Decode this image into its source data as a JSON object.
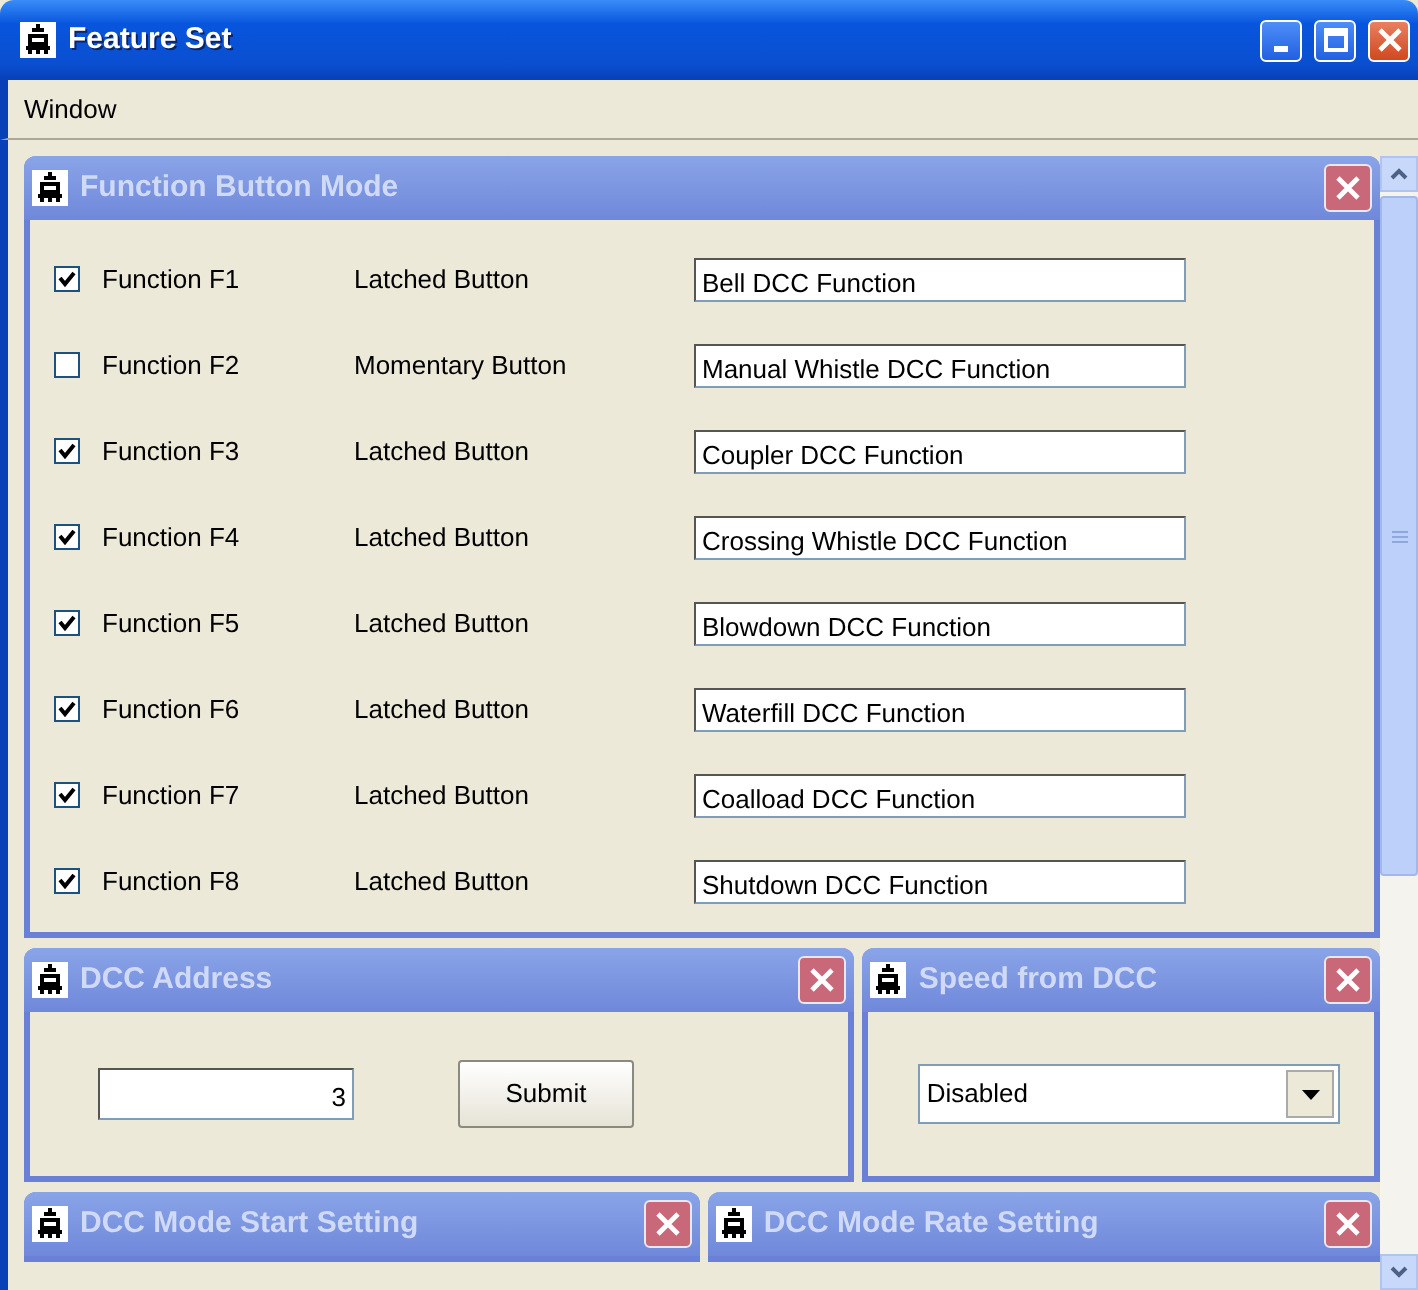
{
  "window": {
    "title": "Feature Set"
  },
  "menu": [
    "Window"
  ],
  "function_panel": {
    "title": "Function Button Mode",
    "rows": [
      {
        "label": "Function F1",
        "checked": true,
        "mode": "Latched Button",
        "value": "Bell DCC Function"
      },
      {
        "label": "Function F2",
        "checked": false,
        "mode": "Momentary Button",
        "value": "Manual Whistle DCC Function"
      },
      {
        "label": "Function F3",
        "checked": true,
        "mode": "Latched Button",
        "value": "Coupler DCC Function"
      },
      {
        "label": "Function F4",
        "checked": true,
        "mode": "Latched Button",
        "value": "Crossing Whistle DCC Function"
      },
      {
        "label": "Function F5",
        "checked": true,
        "mode": "Latched Button",
        "value": "Blowdown DCC Function"
      },
      {
        "label": "Function F6",
        "checked": true,
        "mode": "Latched Button",
        "value": "Waterfill DCC Function"
      },
      {
        "label": "Function F7",
        "checked": true,
        "mode": "Latched Button",
        "value": "Coalload DCC Function"
      },
      {
        "label": "Function F8",
        "checked": true,
        "mode": "Latched Button",
        "value": "Shutdown DCC Function"
      }
    ]
  },
  "address_panel": {
    "title": "DCC Address",
    "value": "3",
    "button": "Submit"
  },
  "speed_panel": {
    "title": "Speed from DCC",
    "value": "Disabled"
  },
  "lower_panels": [
    {
      "title": "DCC Mode Start Setting"
    },
    {
      "title": "DCC Mode Rate Setting"
    }
  ]
}
